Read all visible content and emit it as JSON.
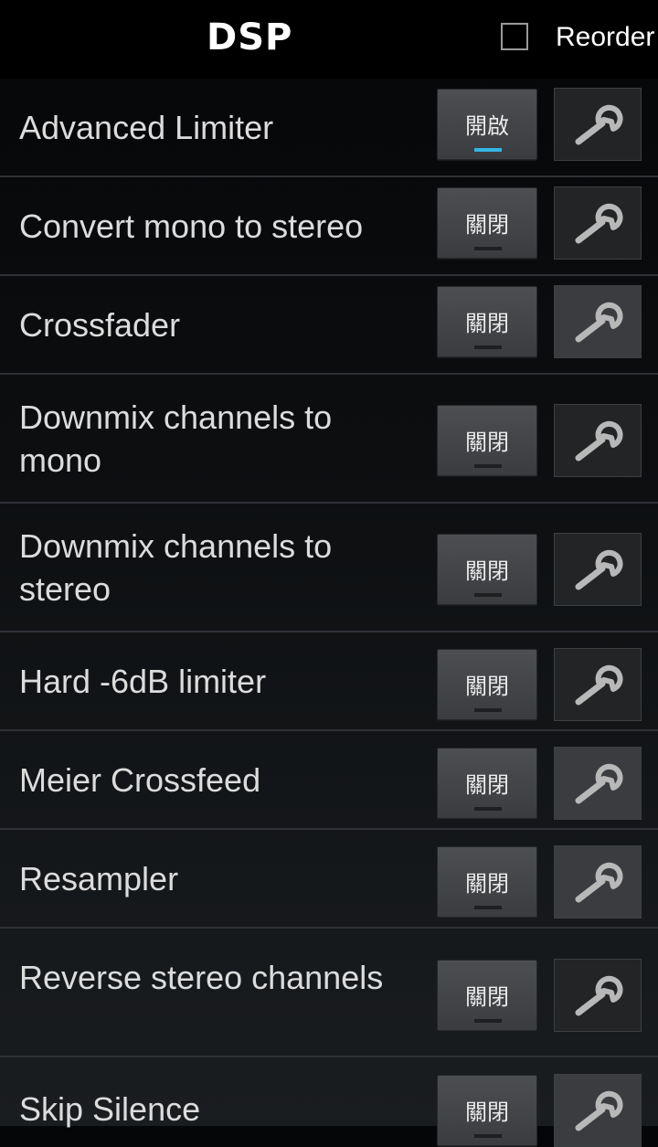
{
  "header": {
    "title": "DSP",
    "reorder_label": "Reorder",
    "reorder_checked": false
  },
  "items": [
    {
      "label": "Advanced Limiter",
      "toggle": "開啟",
      "on": true
    },
    {
      "label": "Convert mono to stereo",
      "toggle": "關閉",
      "on": false
    },
    {
      "label": "Crossfader",
      "toggle": "關閉",
      "on": false
    },
    {
      "label": "Downmix channels to mono",
      "toggle": "關閉",
      "on": false
    },
    {
      "label": "Downmix channels to stereo",
      "toggle": "關閉",
      "on": false
    },
    {
      "label": "Hard -6dB limiter",
      "toggle": "關閉",
      "on": false
    },
    {
      "label": "Meier Crossfeed",
      "toggle": "關閉",
      "on": false
    },
    {
      "label": "Resampler",
      "toggle": "關閉",
      "on": false
    },
    {
      "label": "Reverse stereo channels",
      "toggle": "關閉",
      "on": false
    },
    {
      "label": "Skip Silence",
      "toggle": "關閉",
      "on": false
    }
  ],
  "colors": {
    "accent": "#33b5e5",
    "background": "#000000",
    "text": "#dcdcdc"
  },
  "icons": {
    "settings_button": "wrench-icon"
  }
}
